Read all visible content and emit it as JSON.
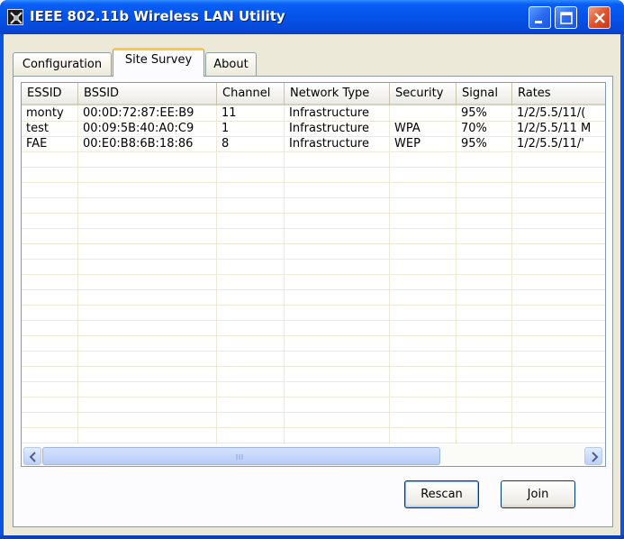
{
  "window": {
    "title": "IEEE 802.11b Wireless LAN Utility",
    "accent_color": "#0a54e3",
    "title_icon": "network-card-icon"
  },
  "title_buttons": {
    "minimize_icon": "minimize-icon",
    "maximize_icon": "maximize-icon",
    "close_icon": "close-icon"
  },
  "tabs": [
    {
      "label": "Configuration",
      "active": false
    },
    {
      "label": "Site Survey",
      "active": true
    },
    {
      "label": "About",
      "active": false
    }
  ],
  "list": {
    "columns": [
      "ESSID",
      "BSSID",
      "Channel",
      "Network Type",
      "Security",
      "Signal",
      "Rates"
    ],
    "rows": [
      [
        "monty",
        "00:0D:72:87:EE:B9",
        "11",
        "Infrastructure",
        "",
        "95%",
        "1/2/5.5/11/("
      ],
      [
        "test",
        "00:09:5B:40:A0:C9",
        "1",
        "Infrastructure",
        "WPA",
        "70%",
        "1/2/5.5/11 M"
      ],
      [
        "FAE",
        "00:E0:B8:6B:18:86",
        "8",
        "Infrastructure",
        "WEP",
        "95%",
        "1/2/5.5/11/'"
      ]
    ]
  },
  "scrollbar": {
    "left_icon": "chevron-left-icon",
    "right_icon": "chevron-right-icon"
  },
  "buttons": {
    "rescan": "Rescan",
    "join": "Join"
  }
}
